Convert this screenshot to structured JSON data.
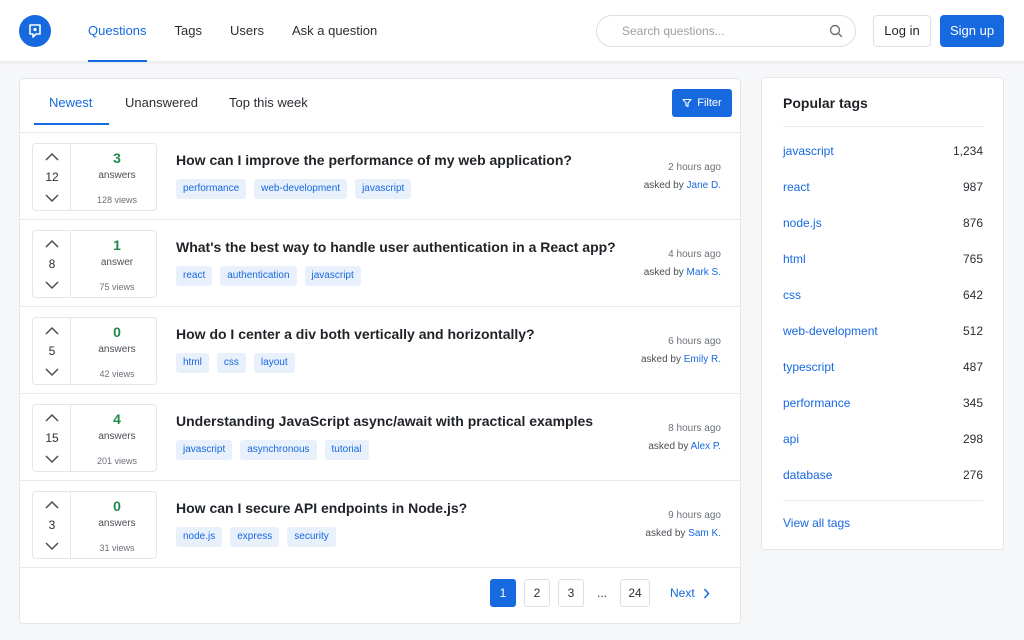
{
  "nav": {
    "items": [
      "Questions",
      "Tags",
      "Users",
      "Ask a question"
    ],
    "search_placeholder": "Search questions...",
    "login_label": "Log in",
    "signup_label": "Sign up"
  },
  "tabs": {
    "items": [
      "Newest",
      "Unanswered",
      "Top this week"
    ],
    "filter_label": "Filter"
  },
  "questions": [
    {
      "votes": "12",
      "answers": "3",
      "answers_label": "answers",
      "views": "128 views",
      "title": "How can I improve the performance of my web application?",
      "tags": [
        "performance",
        "web-development",
        "javascript"
      ],
      "time": "2 hours ago",
      "asked_prefix": "asked by",
      "author": "Jane D."
    },
    {
      "votes": "8",
      "answers": "1",
      "answers_label": "answer",
      "views": "75 views",
      "title": "What's the best way to handle user authentication in a React app?",
      "tags": [
        "react",
        "authentication",
        "javascript"
      ],
      "time": "4 hours ago",
      "asked_prefix": "asked by",
      "author": "Mark S."
    },
    {
      "votes": "5",
      "answers": "0",
      "answers_label": "answers",
      "views": "42 views",
      "title": "How do I center a div both vertically and horizontally?",
      "tags": [
        "html",
        "css",
        "layout"
      ],
      "time": "6 hours ago",
      "asked_prefix": "asked by",
      "author": "Emily R."
    },
    {
      "votes": "15",
      "answers": "4",
      "answers_label": "answers",
      "views": "201 views",
      "title": "Understanding JavaScript async/await with practical examples",
      "tags": [
        "javascript",
        "asynchronous",
        "tutorial"
      ],
      "time": "8 hours ago",
      "asked_prefix": "asked by",
      "author": "Alex P."
    },
    {
      "votes": "3",
      "answers": "0",
      "answers_label": "answers",
      "views": "31 views",
      "title": "How can I secure API endpoints in Node.js?",
      "tags": [
        "node.js",
        "express",
        "security"
      ],
      "time": "9 hours ago",
      "asked_prefix": "asked by",
      "author": "Sam K."
    }
  ],
  "pagination": {
    "pages": [
      "1",
      "2",
      "3"
    ],
    "ellipsis": "...",
    "last": "24",
    "next_label": "Next"
  },
  "sidebar": {
    "title": "Popular tags",
    "tags": [
      {
        "name": "javascript",
        "count": "1,234"
      },
      {
        "name": "react",
        "count": "987"
      },
      {
        "name": "node.js",
        "count": "876"
      },
      {
        "name": "html",
        "count": "765"
      },
      {
        "name": "css",
        "count": "642"
      },
      {
        "name": "web-development",
        "count": "512"
      },
      {
        "name": "typescript",
        "count": "487"
      },
      {
        "name": "performance",
        "count": "345"
      },
      {
        "name": "api",
        "count": "298"
      },
      {
        "name": "database",
        "count": "276"
      }
    ],
    "view_all_label": "View all tags"
  },
  "colors": {
    "accent": "#1769e0",
    "answer_count": "#1f8a4c",
    "tag_bg": "#e8f0fc"
  }
}
